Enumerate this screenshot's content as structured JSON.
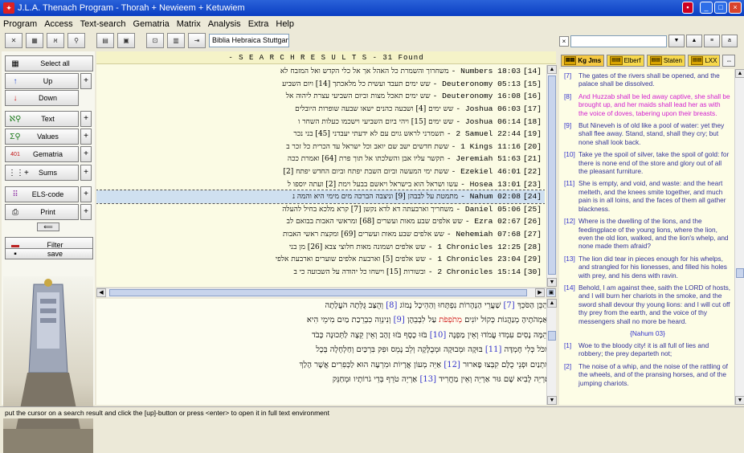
{
  "window": {
    "title": "J.L.A. Thenach Program - Thorah + Newieem + Ketuwiem",
    "buttons": [
      "_",
      "□",
      "×"
    ]
  },
  "menu": [
    "Program",
    "Access",
    "Text-search",
    "Gematria",
    "Matrix",
    "Analysis",
    "Extra",
    "Help"
  ],
  "toolbar": {
    "bible_version": "Biblia Hebraica Stuttgartensia"
  },
  "left_panel": {
    "select_all": "Select all",
    "up": "Up",
    "down": "Down",
    "text": "Text",
    "values": "Values",
    "gematria": "Gematria",
    "sums": "Sums",
    "els_code": "ELS-code",
    "print": "Print",
    "filter": "Filter",
    "save": "save",
    "plus": "+"
  },
  "results": {
    "header": "- S E A R C H   R E S U L T S  -  31 Found",
    "rows": [
      {
        "heb": "משחרוך והשמרת כל האהל אך אל כלי הקדש ואל המזבח לא",
        "ref": "- Numbers 18:03",
        "idx": "[14]"
      },
      {
        "heb": "שש ימים תעבד ועשית כל מלאכתך [14] ויום השביע",
        "ref": "- Deuteronomy 05:13",
        "idx": "[15]"
      },
      {
        "heb": "שש ימים תאכל מצות וביום השביעי עצרת ליהוה אל",
        "ref": "- Deuteronomy 16:08",
        "idx": "[16]"
      },
      {
        "heb": "שש ימים [4] ושבעה כהנים ישאו שבעה שופרות היובלים",
        "ref": "- Joshua 06:03",
        "idx": "[17]"
      },
      {
        "heb": "שש ימים [15] ויהי ביום השביעי וישכמו כעלות השחר ו",
        "ref": "- Joshua 06:14",
        "idx": "[18]"
      },
      {
        "heb": "תשמרני לראש גוים עם לא ידעתי יעבדני [45] בני נכר",
        "ref": "- 2 Samuel 22:44",
        "idx": "[19]"
      },
      {
        "heb": "ששת חדשים ישב שם יואב וכל ישראל עד הכרית כל זכר ב",
        "ref": "- 1 Kings 11:16",
        "idx": "[20]"
      },
      {
        "heb": "תקשר עליו אבן והשלכתו אל תוך פרת [64] ואמרת ככה",
        "ref": "- Jeremiah 51:63",
        "idx": "[21]"
      },
      {
        "heb": "ששת ימי המעשה וביום השבת יפתח וביום החדש יפתח [2]",
        "ref": "- Ezekiel 46:01",
        "idx": "[22]"
      },
      {
        "heb": "עשו ושראל הוא בישראל ויאשם בבעל וימת [2] ועתה יוספו ל",
        "ref": "- Hosea 13:01",
        "idx": "[23]"
      },
      {
        "heb": "מתמטת על לבבהן [9] וניצבה הברכה מים מימי היא והמה נ",
        "ref": "- Nahum 02:08",
        "idx": "[24]",
        "selected": true
      },
      {
        "heb": "משחריך וארבעתה דא לדא נקשן [7] קרא מלכא בחיל להעלה",
        "ref": "- Daniel 05:06",
        "idx": "[25]"
      },
      {
        "heb": "שש אלפים שבע מאות ועשרים [68] ומראשי האבות בבואם לב",
        "ref": "- Ezra 02:67",
        "idx": "[26]"
      },
      {
        "heb": "שש אלפים שבע מאות ועשרים [69] ומקצת ראשי האבות",
        "ref": "- Nehemiah 07:68",
        "idx": "[27]"
      },
      {
        "heb": "שש אלפים ושמונה מאות חלוצי צבא [26] מן בני",
        "ref": "- 1 Chronicles 12:25",
        "idx": "[28]"
      },
      {
        "heb": "שש אלפים [5] וארבעת אלפים שוערים וארבעת אלפי",
        "ref": "- 1 Chronicles 23:04",
        "idx": "[29]"
      },
      {
        "heb": "ובשורות [15] וישחו כל יהודה על השבועה כי ב",
        "ref": "- 2 Chronicles 15:14",
        "idx": "[30]"
      }
    ]
  },
  "fulltext": [
    {
      "pre": "וְהַכֵּן הַסֹּכֵךְ ",
      "n": "[7]",
      "post": " שַׁעֲרֵי הַנְּהָרוֹת נִפְתָּחוּ וְהַהֵיכָל נָמוֹג ",
      "n2": "[8]",
      "post2": " וְהֻצַּב גֻּלְּתָה הֹעֲלָתָה"
    },
    {
      "pre": "וְאַמְהֹתֶיהָ מְנַהֲגוֹת כְּקוֹל יוֹנִים ",
      "hl": "מְתֹפְפֹת",
      "post": " עַל לִבְבֵהֶן ",
      "n2": "[9]",
      "post2": " וְנִינְוֵה כִבְרֵכַת מַיִם מִימֵי הִיא"
    },
    {
      "pre": "וְהֵמָּה נָסִים עִמְדוּ עֲמֹדוּ וְאֵין מַפְנֶה ",
      "n": "[10]",
      "post": " בֹּזּוּ כֶסֶף בֹּזּוּ זָהָב וְאֵין קֵצֶה לַתְּכוּנָה כָּבֹד",
      "n2": "",
      "post2": ""
    },
    {
      "pre": "מִכֹּל כְּלִי חֶמְדָּה ",
      "n": "[11]",
      "post": " בּוּקָה וּמְבוּקָה וּמְבֻלָּקָה וְלֵב נָמֵס וּפִק בִּרְכַּיִם וְחַלְחָלָה בְּכָל",
      "n2": "",
      "post2": ""
    },
    {
      "pre": "מָתְנַיִם וּפְנֵי כֻלָּם קִבְּצוּ פָארוּר ",
      "n": "[12]",
      "post": " אַיֵּה מְעוֹן אֲרָיוֹת וּמִרְעֶה הוּא לַכְּפִרִים אֲשֶׁר הָלַךְ",
      "n2": "",
      "post2": ""
    },
    {
      "pre": "אַרְיֵה לָבִיא שָׁם גּוּר אַרְיֵה וְאֵין מַחֲרִיד ",
      "n": "[13]",
      "post": " אַרְיֵה טֹרֵף בְּדֵי גֹרוֹתָיו וּמְחַנֵּק",
      "n2": "",
      "post2": ""
    }
  ],
  "translation": {
    "tabs": [
      "Kg Jms",
      "Elberf",
      "Staten",
      "LXX"
    ],
    "verses": [
      {
        "n": "[7]",
        "t": "The gates of the rivers shall be opened, and the palace shall be dissolved."
      },
      {
        "n": "[8]",
        "t": "And Huzzab shall be led away captive, she shall be brought up, and her maids shall lead her as with the voice of doves, tabering upon their breasts.",
        "pink": true
      },
      {
        "n": "[9]",
        "t": "But Nineveh is of old like a pool of water: yet they shall flee away. Stand, stand, shall they cry; but none shall look back."
      },
      {
        "n": "[10]",
        "t": "Take ye the spoil of silver, take the spoil of gold: for there is none end of the store and glory out of all the pleasant furniture."
      },
      {
        "n": "[11]",
        "t": "She is empty, and void, and waste: and the heart melteth, and the knees smite together, and much pain is in all loins, and the faces of them all gather blackness."
      },
      {
        "n": "[12]",
        "t": "Where is the dwelling of the lions, and the feedingplace of the young lions, where the lion, even the old lion, walked, and the lion's whelp, and none made them afraid?"
      },
      {
        "n": "[13]",
        "t": "The lion did tear in pieces enough for his whelps, and strangled for his lionesses, and filled his holes with prey, and his dens with ravin."
      },
      {
        "n": "[14]",
        "t": "Behold, I am against thee, saith the LORD of hosts, and I will burn her chariots in the smoke, and the sword shall devour thy young lions: and I will cut off thy prey from the earth, and the voice of thy messengers shall no more be heard."
      }
    ],
    "chapter_head": "{Nahum 03}",
    "verses2": [
      {
        "n": "[1]",
        "t": "Woe to the bloody city! it is all full of lies and robbery; the prey departeth not;"
      },
      {
        "n": "[2]",
        "t": "The noise of a whip, and the noise of the rattling of the wheels, and of the pransing horses, and of the jumping chariots."
      }
    ]
  },
  "status": "put the cursor on a search result and click the [up]-button or press <enter> to open it in full text environment"
}
